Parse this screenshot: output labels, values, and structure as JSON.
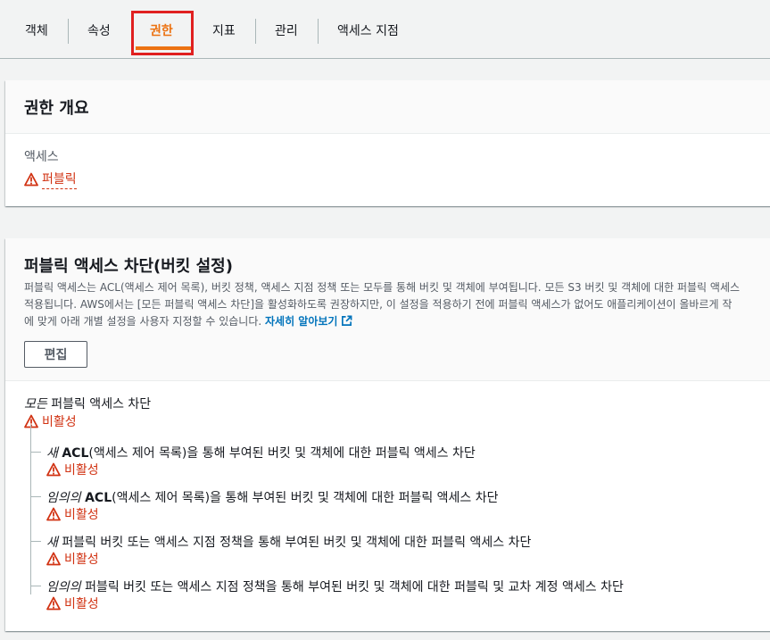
{
  "tabs": [
    {
      "label": "객체"
    },
    {
      "label": "속성"
    },
    {
      "label": "권한"
    },
    {
      "label": "지표"
    },
    {
      "label": "관리"
    },
    {
      "label": "액세스 지점"
    }
  ],
  "overview": {
    "title": "권한 개요",
    "access_label": "액세스",
    "access_value": "퍼블릭"
  },
  "block_public": {
    "title": "퍼블릭 액세스 차단(버킷 설정)",
    "desc_line1": "퍼블릭 액세스는 ACL(액세스 제어 목록), 버킷 정책, 액세스 지점 정책 또는 모두를 통해 버킷 및 객체에 부여됩니다. 모든 S3 버킷 및 객체에 대한 퍼블릭 액세스",
    "desc_line2": "적용됩니다. AWS에서는 [모든 퍼블릭 액세스 차단]을 활성화하도록 권장하지만, 이 설정을 적용하기 전에 퍼블릭 액세스가 없어도 애플리케이션이 올바르게 작",
    "desc_line3": "에 맞게 아래 개별 설정을 사용자 지정할 수 있습니다.",
    "learn_more": "자세히 알아보기",
    "edit_button": "편집",
    "all": {
      "prefix": "모든",
      "text": "퍼블릭 액세스 차단",
      "status": "비활성"
    },
    "settings": [
      {
        "prefix": "새",
        "bold": "ACL",
        "text": "(액세스 제어 목록)을 통해 부여된 버킷 및 객체에 대한 퍼블릭 액세스 차단",
        "status": "비활성"
      },
      {
        "prefix": "임의의",
        "bold": "ACL",
        "text": "(액세스 제어 목록)을 통해 부여된 버킷 및 객체에 대한 퍼블릭 액세스 차단",
        "status": "비활성"
      },
      {
        "prefix": "새",
        "bold": "",
        "text": "퍼블릭 버킷 또는 액세스 지점 정책을 통해 부여된 버킷 및 객체에 대한 퍼블릭 액세스 차단",
        "status": "비활성"
      },
      {
        "prefix": "임의의",
        "bold": "",
        "text": "퍼블릭 버킷 또는 액세스 지점 정책을 통해 부여된 버킷 및 객체에 대한 퍼블릭 및 교차 계정 액세스 차단",
        "status": "비활성"
      }
    ]
  },
  "colors": {
    "accent": "#ec7211",
    "warning": "#d13212",
    "link": "#0073bb",
    "highlight": "#e02020"
  },
  "icons": {
    "warning": "warning-icon",
    "external": "external-link-icon"
  }
}
